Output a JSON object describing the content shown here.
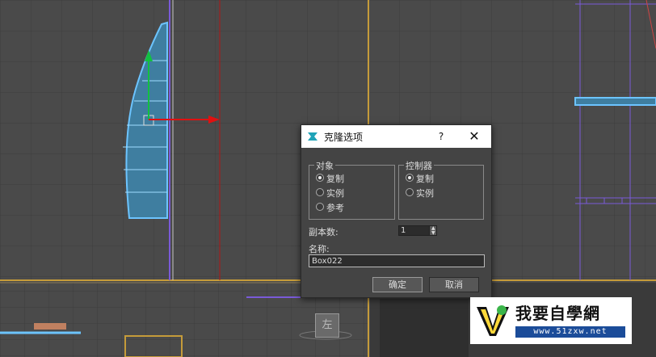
{
  "dialog": {
    "title": "克隆选项",
    "help_label": "?",
    "close_label": "✕",
    "object_group": {
      "legend": "对象",
      "options": [
        "复制",
        "实例",
        "参考"
      ],
      "selected": "复制"
    },
    "controller_group": {
      "legend": "控制器",
      "options": [
        "复制",
        "实例"
      ],
      "selected": "复制"
    },
    "copies_label": "副本数:",
    "copies_value": "1",
    "name_label": "名称:",
    "name_value": "Box022",
    "ok_label": "确定",
    "cancel_label": "取消"
  },
  "viewport": {
    "left_label": "左"
  },
  "watermark": {
    "title": "我要自學網",
    "url": "www.51zxw.net"
  },
  "colors": {
    "viewport_bg": "#4a4a4a",
    "grid": "#3c3c3c",
    "object_outline": "#6cc4ff",
    "object_fill": "#3f7ea0",
    "x_axis": "#e01010",
    "y_axis": "#12c040",
    "viewport_border": "#c59b3a",
    "purple_line": "#7a5ad8"
  }
}
